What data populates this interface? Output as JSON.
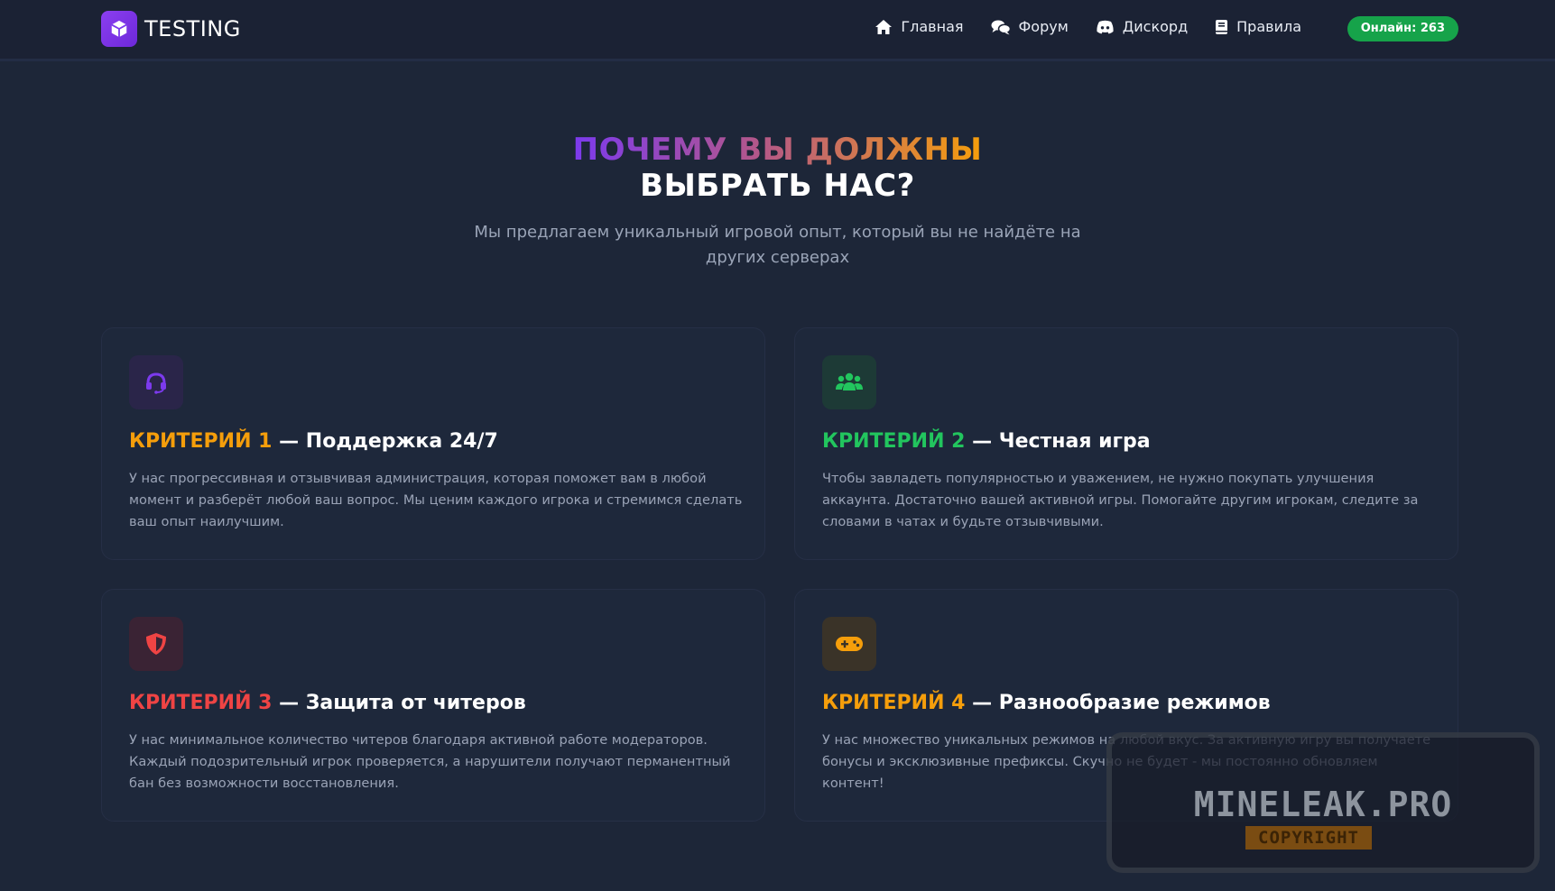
{
  "header": {
    "logo_text": "TESTING",
    "nav": [
      {
        "label": "Главная",
        "icon": "home-icon"
      },
      {
        "label": "Форум",
        "icon": "comments-icon"
      },
      {
        "label": "Дискорд",
        "icon": "discord-icon"
      },
      {
        "label": "Правила",
        "icon": "book-icon"
      }
    ],
    "online": "Онлайн: 263"
  },
  "hero": {
    "title_line1": "ПОЧЕМУ ВЫ ДОЛЖНЫ",
    "title_line2": "ВЫБРАТЬ НАС?",
    "subtitle": "Мы предлагаем уникальный игровой опыт, который вы не найдёте на других серверах"
  },
  "cards": [
    {
      "criterion": "КРИТЕРИЙ 1",
      "title": "— Поддержка 24/7",
      "text": "У нас прогрессивная и отзывчивая администрация, которая поможет вам в любой момент и разберёт любой ваш вопрос. Мы ценим каждого игрока и стремимся сделать ваш опыт наилучшим.",
      "icon": "headset-icon",
      "accent": "#f59e0b",
      "icon_color": "#7c3aed"
    },
    {
      "criterion": "КРИТЕРИЙ 2",
      "title": "— Честная игра",
      "text": "Чтобы завладеть популярностью и уважением, не нужно покупать улучшения аккаунта. Достаточно вашей активной игры. Помогайте другим игрокам, следите за словами в чатах и будьте отзывчивыми.",
      "icon": "users-icon",
      "accent": "#22c55e",
      "icon_color": "#22c55e"
    },
    {
      "criterion": "КРИТЕРИЙ 3",
      "title": "— Защита от читеров",
      "text": "У нас минимальное количество читеров благодаря активной работе модераторов. Каждый подозрительный игрок проверяется, а нарушители получают перманентный бан без возможности восстановления.",
      "icon": "shield-icon",
      "accent": "#ef4444",
      "icon_color": "#ef4444"
    },
    {
      "criterion": "КРИТЕРИЙ 4",
      "title": "— Разнообразие режимов",
      "text": "У нас множество уникальных режимов на любой вкус. За активную игру вы получаете бонусы и эксклюзивные префиксы. Скучно не будет - мы постоянно обновляем контент!",
      "icon": "gamepad-icon",
      "accent": "#f59e0b",
      "icon_color": "#f59e0b"
    }
  ],
  "watermark": {
    "main": "MINELEAK.PRO",
    "sub": "COPYRIGHT"
  }
}
